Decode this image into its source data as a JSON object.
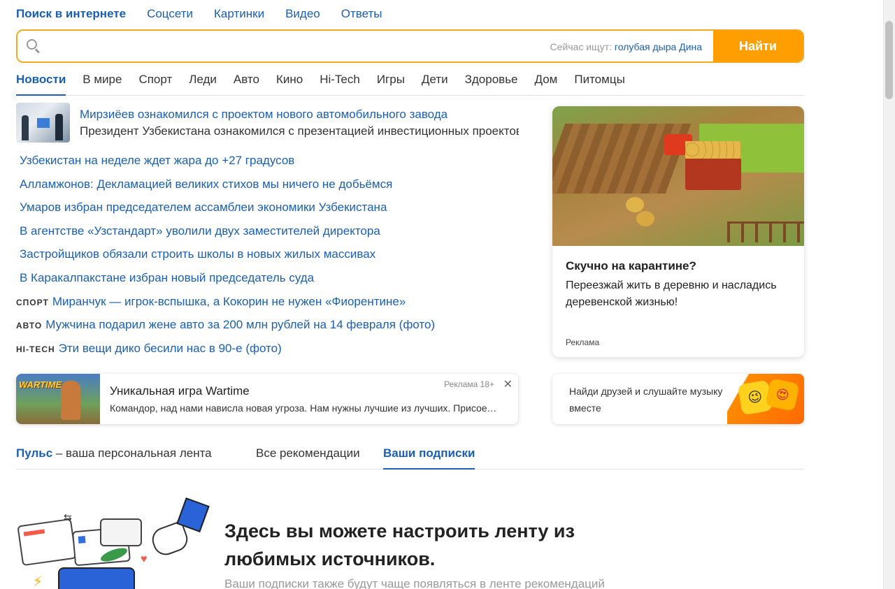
{
  "topnav": [
    "Поиск в интернете",
    "Соцсети",
    "Картинки",
    "Видео",
    "Ответы"
  ],
  "search": {
    "hint_label": "Сейчас ищут:",
    "hint_query": "голубая дыра Дина",
    "button": "Найти"
  },
  "categories": [
    "Новости",
    "В мире",
    "Спорт",
    "Леди",
    "Авто",
    "Кино",
    "Hi-Tech",
    "Игры",
    "Дети",
    "Здоровье",
    "Дом",
    "Питомцы"
  ],
  "lead": {
    "title": "Мирзиёев ознакомился с проектом нового автомобильного завода",
    "subtitle": "Президент Узбекистана ознакомился с презентацией инвестиционных проектов"
  },
  "news": [
    {
      "tag": "",
      "text": "Узбекистан на неделе ждет жара до +27 градусов"
    },
    {
      "tag": "",
      "text": "Алламжонов: Декламацией великих стихов мы ничего не добьёмся"
    },
    {
      "tag": "",
      "text": "Умаров избран председателем ассамблеи экономики Узбекистана"
    },
    {
      "tag": "",
      "text": "В агентстве «Узстандарт» уволили двух заместителей директора"
    },
    {
      "tag": "",
      "text": "Застройщиков обязали строить школы в новых жилых массивах"
    },
    {
      "tag": "",
      "text": "В Каракалпакстане избран новый председатель суда"
    },
    {
      "tag": "СПОРТ",
      "text": "Миранчук — игрок-вспышка, а Кокорин не нужен «Фиорентине»"
    },
    {
      "tag": "АВТО",
      "text": "Мужчина подарил жене авто за 200 млн рублей на 14 февраля (фото)"
    },
    {
      "tag": "HI-TECH",
      "text": "Эти вещи дико бесили нас в 90-е (фото)"
    }
  ],
  "ad_card": {
    "title": "Скучно на карантине?",
    "text": "Переезжай жить в деревню и насладись деревенской жизнью!",
    "label": "Реклама"
  },
  "game_ad": {
    "logo": "WARTIME",
    "title": "Уникальная игра Wartime",
    "text": "Командор, над нами нависла новая угроза. Нам нужны лучшие из лучших. Присоединяйся!",
    "label": "Реклама 18+",
    "close": "✕"
  },
  "friends": {
    "text": "Найди друзей и слушайте музыку вместе"
  },
  "feed_tabs": {
    "pulse_bold": "Пульс",
    "pulse_rest": " – ваша персональная лента",
    "all": "Все рекомендации",
    "subs": "Ваши подписки"
  },
  "promo": {
    "title": "Здесь вы можете настроить ленту из любимых источников.",
    "subtitle": "Ваши подписки также будут чаще появляться в ленте рекомендаций"
  },
  "colors": {
    "link": "#1a5fb4",
    "accent": "#ff9e00",
    "search_border": "#f5a623"
  }
}
